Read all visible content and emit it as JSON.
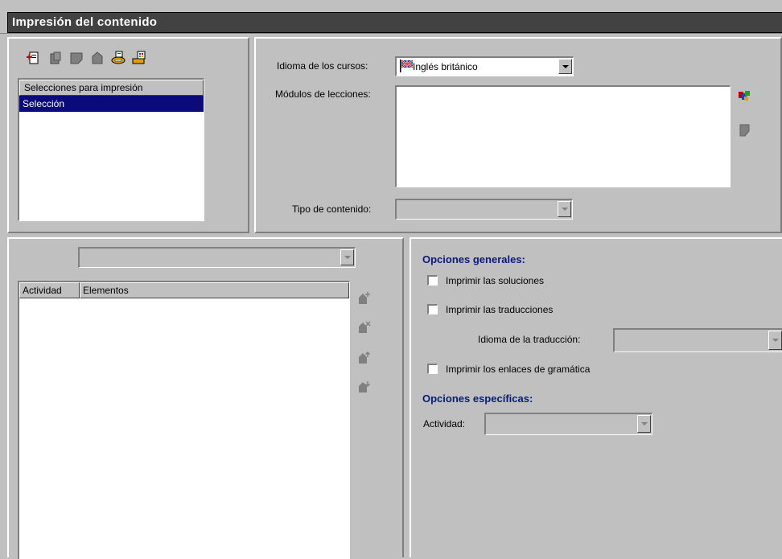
{
  "window": {
    "title": "Impresión del contenido"
  },
  "toolbar": {
    "icons": [
      "new-selection-icon",
      "copy-selection-icon",
      "rename-selection-icon",
      "delete-selection-icon",
      "print-icon",
      "print-preview-icon"
    ]
  },
  "selections": {
    "header": "Selecciones para impresión",
    "items": [
      {
        "label": "Selección",
        "selected": true
      }
    ]
  },
  "course": {
    "language_label": "Idioma de los cursos:",
    "language_value": "Inglés británico",
    "modules_label": "Módulos de lecciones:",
    "content_type_label": "Tipo de contenido:",
    "content_type_value": ""
  },
  "activities": {
    "filter_value": "",
    "columns": [
      "Actividad",
      "Elementos"
    ],
    "rows": [],
    "side_icons": [
      "add-activity-icon",
      "remove-activity-icon",
      "move-up-icon",
      "move-down-icon"
    ]
  },
  "options": {
    "general_title": "Opciones generales:",
    "print_solutions": "Imprimir las soluciones",
    "print_translations": "Imprimir las traducciones",
    "translation_language_label": "Idioma de la traducción:",
    "translation_language_value": "",
    "print_grammar_links": "Imprimir los enlaces de gramática",
    "specific_title": "Opciones específicas:",
    "activity_label": "Actividad:",
    "activity_value": ""
  },
  "colors": {
    "title_bar": "#424242",
    "selection_highlight": "#0a0a7a",
    "section_title": "#0a1a7a",
    "face": "#c0c0c0"
  }
}
